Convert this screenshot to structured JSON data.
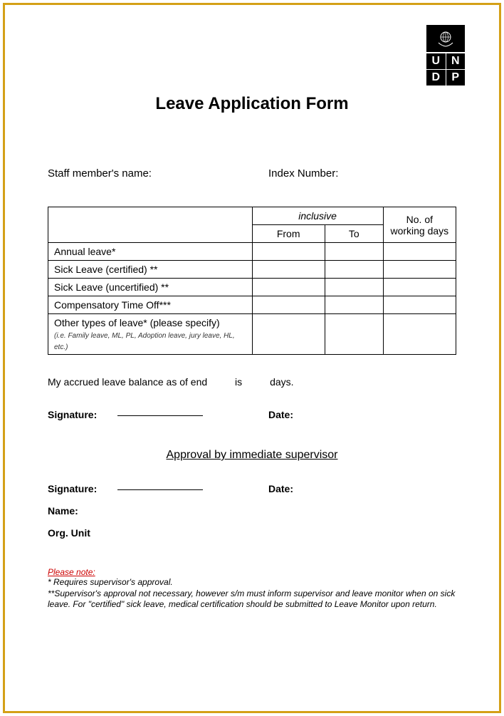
{
  "logo": {
    "letters": [
      "U",
      "N",
      "D",
      "P"
    ]
  },
  "title": "Leave Application Form",
  "fields": {
    "staff_name": "Staff member's name:",
    "index_number": "Index Number:"
  },
  "table": {
    "inclusive": "inclusive",
    "from": "From",
    "to": "To",
    "days": "No. of working days",
    "rows": {
      "annual": "Annual leave*",
      "sick_cert": "Sick Leave (certified) **",
      "sick_uncert": "Sick Leave (uncertified) **",
      "cto": "Compensatory Time Off***",
      "other": "Other types of leave* (please specify)",
      "other_sub": "(i.e. Family leave, ML, PL, Adoption leave, jury leave, HL, etc.)"
    }
  },
  "balance": {
    "prefix": "My accrued leave balance as of end",
    "mid": "is",
    "suffix": "days."
  },
  "signature_label": "Signature:",
  "date_label": "Date:",
  "approval_heading": "Approval by immediate supervisor",
  "name_label": "Name:",
  "org_label": "Org. Unit",
  "note": {
    "title": "Please note:",
    "line1": "* Requires supervisor's approval.",
    "line2": "**Supervisor's approval not necessary, however s/m must inform supervisor and leave monitor when on sick leave.  For \"certified\" sick leave, medical certification should be submitted to Leave Monitor upon return."
  }
}
